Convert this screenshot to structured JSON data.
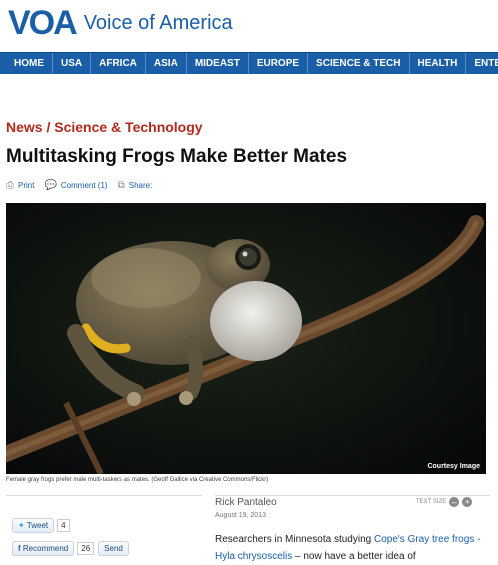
{
  "brand": {
    "mark": "VOA",
    "name": "Voice of America"
  },
  "nav": [
    "HOME",
    "USA",
    "AFRICA",
    "ASIA",
    "MIDEAST",
    "EUROPE",
    "SCIENCE & TECH",
    "HEALTH",
    "ENTERTAINMENT"
  ],
  "section": "News / Science & Technology",
  "title": "Multitasking Frogs Make Better Mates",
  "tools": {
    "print": "Print",
    "comment": "Comment (1)",
    "share": "Share:"
  },
  "photo": {
    "credit": "Courtesy Image",
    "caption": "Female gray frogs prefer male multi-taskers as mates. (Geoff Gallice via Creative Commons/Flickr)"
  },
  "article": {
    "author": "Rick Pantaleo",
    "date": "August 19, 2013",
    "text_size": "TEXT SIZE",
    "intro_before": "Researchers in Minnesota studying ",
    "intro_link": "Cope's Gray tree frogs - Hyla chrysoscelis",
    "intro_after": " – now have a better idea of"
  },
  "social": {
    "tweet": "Tweet",
    "tweet_count": "4",
    "recommend": "Recommend",
    "recommend_count": "26",
    "send": "Send"
  },
  "colors": {
    "brand_blue": "#1a5ea8",
    "section_red": "#b02a1e"
  }
}
